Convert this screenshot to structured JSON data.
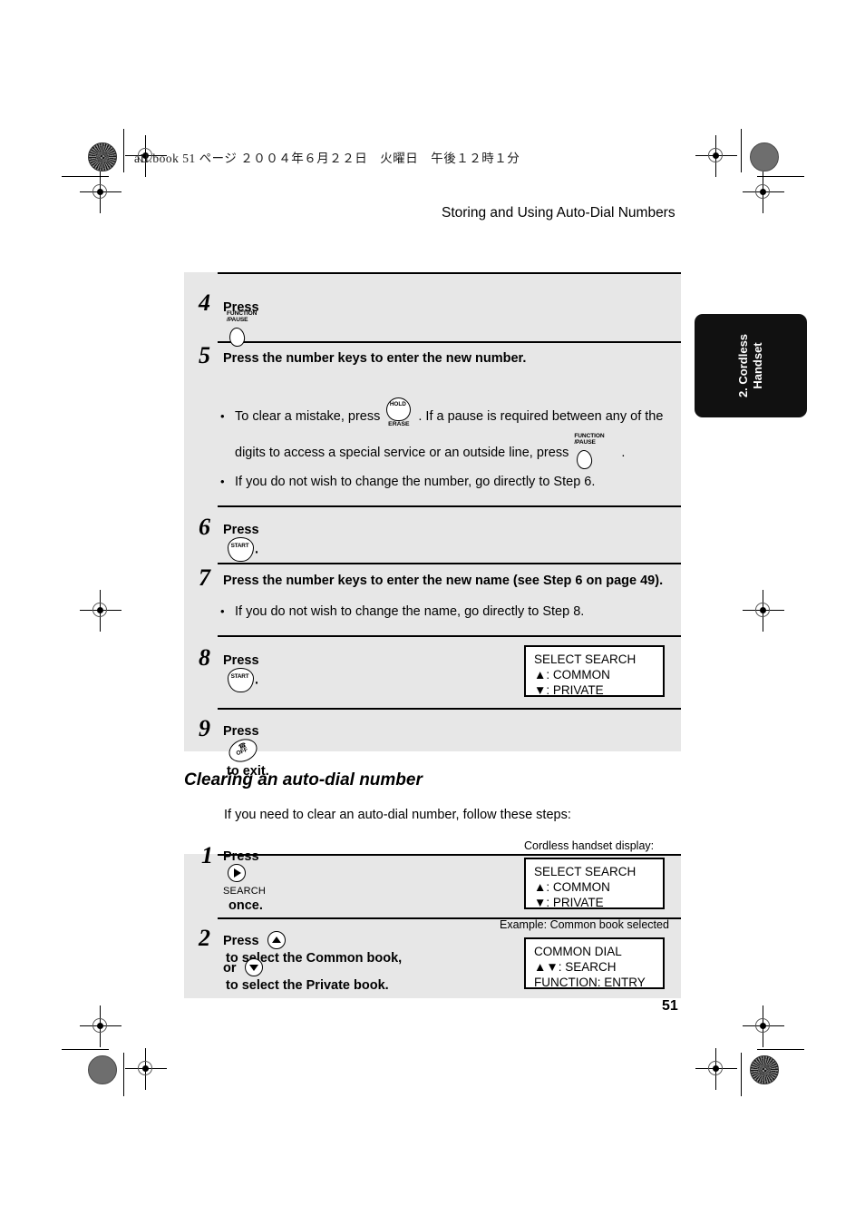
{
  "page": {
    "book_header": "aII.book  51 ページ  ２００４年６月２２日　火曜日　午後１２時１分",
    "running_head": "Storing and Using Auto-Dial Numbers",
    "page_number": "51",
    "side_tab": "2. Cordless\nHandset"
  },
  "keys": {
    "function_pause": "FUNCTION\n/PAUSE",
    "function_label_line1": "FUNCTION",
    "function_label_line2": "/PAUSE",
    "hold": "HOLD",
    "erase": "ERASE",
    "start": "START",
    "off": "OFF",
    "search": "SEARCH"
  },
  "steps_upper": [
    {
      "number": "4",
      "title_prefix": "Press",
      "title_suffix": ".",
      "key": "function-pause"
    },
    {
      "number": "5",
      "title": "Press the number keys to enter the new number.",
      "bullets": [
        {
          "part1": "To clear a mistake, press",
          "part2": ". If a pause is required between any of the",
          "part3": "digits to access a special service or an outside line, press",
          "part4": "."
        },
        {
          "text": "If you do not wish to change the number, go directly to Step 6."
        }
      ]
    },
    {
      "number": "6",
      "title_prefix": "Press",
      "title_suffix": ".",
      "key": "start"
    },
    {
      "number": "7",
      "title": "Press the number keys to enter the new name (see Step 6 on page 49).",
      "bullets": [
        {
          "text": "If you do not wish to change the name, go directly to Step 8."
        }
      ]
    },
    {
      "number": "8",
      "title_prefix": "Press",
      "title_suffix": ".",
      "key": "start",
      "lcd": "SELECT SEARCH\n▲: COMMON\n▼: PRIVATE"
    },
    {
      "number": "9",
      "title_prefix": "Press",
      "title_suffix": "to exit.",
      "key": "off"
    }
  ],
  "section": {
    "heading": "Clearing an auto-dial number",
    "intro": "If you need to clear an auto-dial number, follow these steps:"
  },
  "steps_lower": [
    {
      "number": "1",
      "title_prefix": "Press",
      "title_suffix": "once.",
      "key": "search",
      "lcd_caption": "Cordless handset display:",
      "lcd": "SELECT SEARCH\n▲: COMMON\n▼: PRIVATE"
    },
    {
      "number": "2",
      "line1_prefix": "Press",
      "line1_suffix": "to select the Common book,",
      "line2_prefix": "or",
      "line2_suffix": "to select the Private book.",
      "lcd_caption": "Example: Common book selected",
      "lcd": "COMMON DIAL\n▲▼: SEARCH\nFUNCTION: ENTRY"
    }
  ]
}
